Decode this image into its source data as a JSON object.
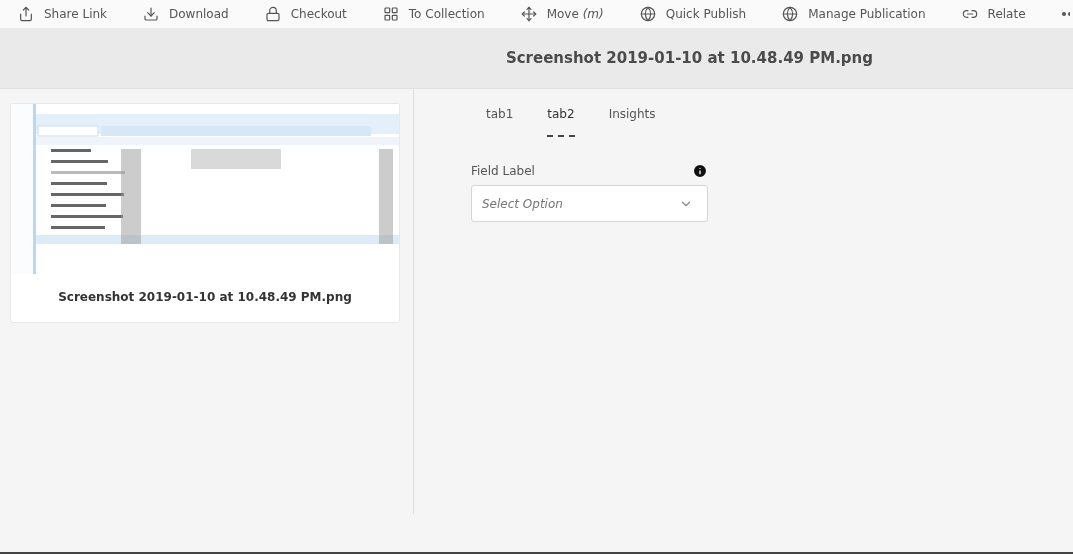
{
  "toolbar": [
    {
      "label": "Share Link"
    },
    {
      "label": "Download"
    },
    {
      "label": "Checkout"
    },
    {
      "label": "To Collection"
    },
    {
      "label": "Move *(m)*"
    },
    {
      "label": "Quick Publish"
    },
    {
      "label": "Manage Publication"
    },
    {
      "label": "Relate"
    }
  ],
  "title": "Screenshot 2019-01-10 at 10.48.49 PM.png",
  "card": {
    "caption": "Screenshot 2019-01-10 at 10.48.49 PM.png"
  },
  "tabs": [
    {
      "label": "tab1",
      "selected": false
    },
    {
      "label": "tab2",
      "selected": true
    },
    {
      "label": "Insights",
      "selected": false
    }
  ],
  "field": {
    "label": "Field Label",
    "placeholder": "Select Option"
  }
}
